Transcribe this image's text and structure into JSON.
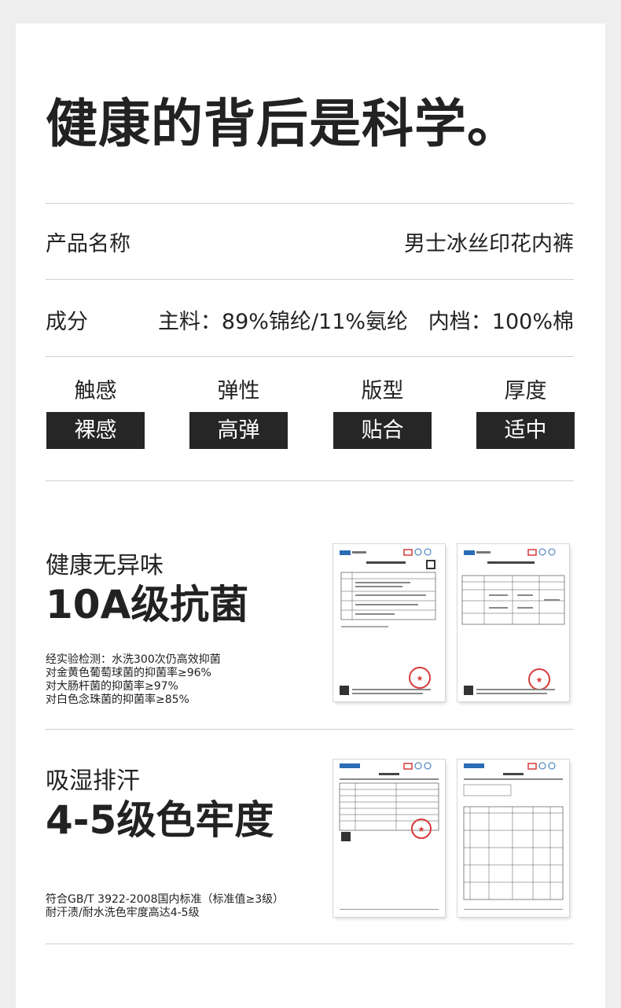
{
  "title": "健康的背后是科学。",
  "product": {
    "label": "产品名称",
    "value": "男士冰丝印花内裤"
  },
  "composition": {
    "label": "成分",
    "value": "主料：89%锦纶/11%氨纶   内档：100%棉"
  },
  "attributes": [
    {
      "name": "触感",
      "value": "裸感"
    },
    {
      "name": "弹性",
      "value": "高弹"
    },
    {
      "name": "版型",
      "value": "贴合"
    },
    {
      "name": "厚度",
      "value": "适中"
    }
  ],
  "antibacterial": {
    "subtitle": "健康无异味",
    "headline": "10A级抗菌",
    "details": [
      "经实验检测：水洗300次仍高效抑菌",
      "对金黄色葡萄球菌的抑菌率≥96%",
      "对大肠杆菌的抑菌率≥97%",
      "对白色念珠菌的抑菌率≥85%"
    ]
  },
  "colorfastness": {
    "subtitle": "吸湿排汗",
    "headline": "4-5级色牢度",
    "details": [
      "符合GB/T 3922-2008国内标准（标准值≥3级）",
      "耐汗渍/耐水洗色牢度高达4-5级"
    ]
  },
  "colors": {
    "badge_bg": "#262626",
    "stamp_red": "#d83a3a",
    "divider": "#d0d0d0"
  },
  "icons": {
    "report": "test-report-document",
    "stamp": "red-seal-stamp"
  }
}
